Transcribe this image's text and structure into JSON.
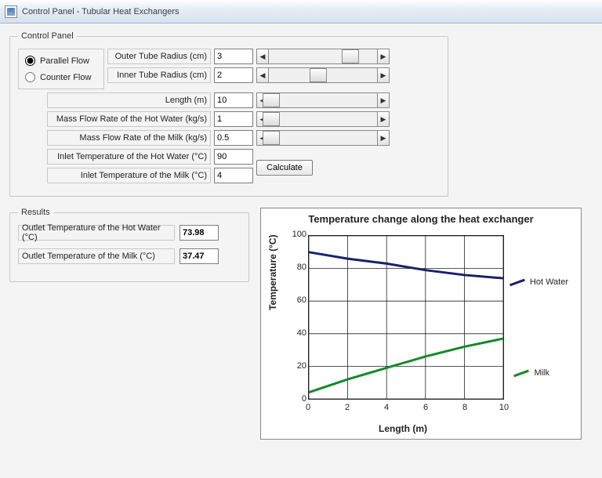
{
  "window": {
    "title": "Control Panel - Tubular Heat Exchangers"
  },
  "control_panel": {
    "legend": "Control Panel",
    "flow": {
      "parallel": "Parallel Flow",
      "counter": "Counter Flow",
      "selected": "parallel"
    },
    "params": {
      "outer_radius": {
        "label": "Outer Tube Radius (cm)",
        "value": "3",
        "thumb_pct": 75
      },
      "inner_radius": {
        "label": "Inner Tube Radius (cm)",
        "value": "2",
        "thumb_pct": 46
      },
      "length": {
        "label": "Length (m)",
        "value": "10",
        "thumb_pct": 2
      },
      "hot_flow": {
        "label": "Mass Flow Rate of the Hot Water (kg/s)",
        "value": "1",
        "thumb_pct": 2
      },
      "milk_flow": {
        "label": "Mass Flow Rate of the Milk (kg/s)",
        "value": "0.5",
        "thumb_pct": 2
      },
      "hot_inlet": {
        "label": "Inlet Temperature of the Hot Water (°C)",
        "value": "90"
      },
      "milk_inlet": {
        "label": "Inlet Temperature of the Milk (°C)",
        "value": "4"
      }
    },
    "calculate": "Calculate"
  },
  "results": {
    "legend": "Results",
    "hot_outlet": {
      "label": "Outlet Temperature of the Hot Water (°C)",
      "value": "73.98"
    },
    "milk_outlet": {
      "label": "Outlet Temperature of the Milk (°C)",
      "value": "37.47"
    }
  },
  "chart_data": {
    "type": "line",
    "title": "Temperature change along the heat exchanger",
    "xlabel": "Length (m)",
    "ylabel": "Temperature (°C)",
    "xlim": [
      0,
      10
    ],
    "ylim": [
      0,
      100
    ],
    "xticks": [
      0,
      2,
      4,
      6,
      8,
      10
    ],
    "yticks": [
      0,
      20,
      40,
      60,
      80,
      100
    ],
    "series": [
      {
        "name": "Hot Water",
        "color": "#16226d",
        "x": [
          0,
          2,
          4,
          6,
          8,
          10
        ],
        "y": [
          90,
          86,
          83,
          79,
          76,
          74
        ]
      },
      {
        "name": "Milk",
        "color": "#128a2a",
        "x": [
          0,
          2,
          4,
          6,
          8,
          10
        ],
        "y": [
          4,
          12,
          19,
          26,
          32,
          37
        ]
      }
    ]
  }
}
